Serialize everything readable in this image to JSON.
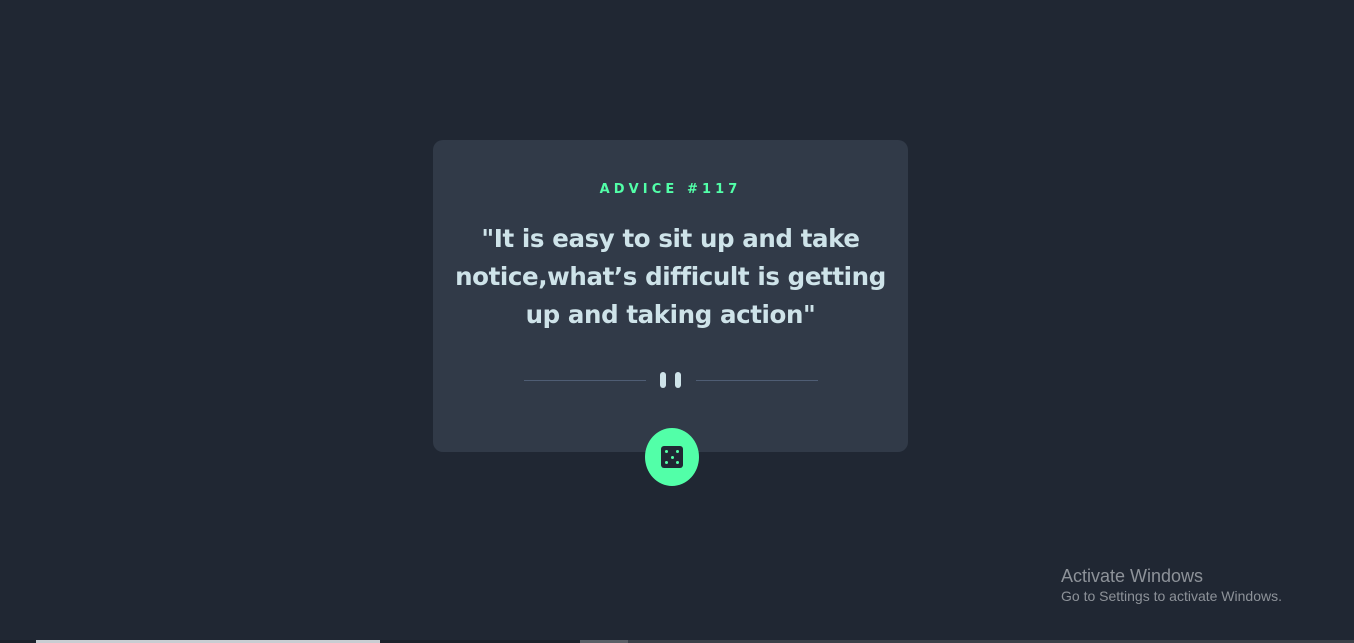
{
  "theme": {
    "background": "#202733",
    "card_background": "#313a48",
    "accent": "#52ffa8",
    "text": "#cee3e9",
    "divider": "#4f5d74"
  },
  "card": {
    "advice_label": "ADVICE #117",
    "advice_text": "\"It is easy to sit up and take notice,what’s difficult is getting up and taking action\"",
    "divider_icon": "pause-icon"
  },
  "generate_button": {
    "icon": "dice-icon"
  },
  "watermark": {
    "title": "Activate Windows",
    "subtitle": "Go to Settings to activate Windows."
  }
}
